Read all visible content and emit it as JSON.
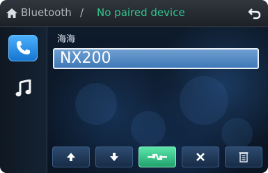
{
  "header": {
    "title": "Bluetooth",
    "separator": "/",
    "device_status": "No paired device",
    "home_icon": "home-icon",
    "back_icon": "back-icon"
  },
  "sidebar": {
    "items": [
      {
        "icon": "phone-icon",
        "active": true
      },
      {
        "icon": "music-note-icon",
        "active": false
      }
    ]
  },
  "main": {
    "name_label": "海海",
    "device_field_value": "NX200"
  },
  "toolbar": {
    "buttons": [
      {
        "icon": "arrow-up-icon"
      },
      {
        "icon": "arrow-down-icon"
      },
      {
        "icon": "pair-connect-icon",
        "active": true
      },
      {
        "icon": "close-icon"
      },
      {
        "icon": "delete-trash-icon"
      }
    ]
  },
  "colors": {
    "accent_green": "#31c48d",
    "accent_blue": "#1f7fe0",
    "header_text": "#aeb5bc"
  }
}
